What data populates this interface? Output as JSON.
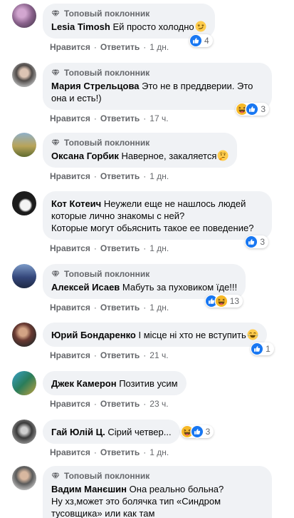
{
  "colors": {
    "bubble": "#f0f2f5",
    "text": "#050505",
    "secondary_text": "#65676b",
    "like_blue": "#1877f2",
    "haha_yellow": "#f7b928"
  },
  "separator": "·",
  "comments": [
    {
      "badge": "Топовый поклонник",
      "badge_icon": "diamond-icon",
      "author": "Lesia Timosh",
      "text": "Ей просто холодно",
      "text_emoji": "smirking-face-emoji-icon",
      "reactions": {
        "icons": [
          "like-reaction-icon"
        ],
        "count": "4"
      },
      "actions": {
        "like": "Нравится",
        "reply": "Ответить",
        "time": "1 дн."
      }
    },
    {
      "badge": "Топовый поклонник",
      "badge_icon": "diamond-icon",
      "author": "Мария Стрельцова",
      "text": "Это не в преддверии. Это она и есть!)",
      "reactions": {
        "icons": [
          "haha-reaction-icon",
          "like-reaction-icon"
        ],
        "count": "3"
      },
      "actions": {
        "like": "Нравится",
        "reply": "Ответить",
        "time": "17 ч."
      }
    },
    {
      "badge": "Топовый поклонник",
      "badge_icon": "diamond-icon",
      "author": "Оксана Горбик",
      "text": "Наверное, закаляется",
      "text_emoji": "thinking-face-emoji-icon",
      "actions": {
        "like": "Нравится",
        "reply": "Ответить",
        "time": "1 дн."
      }
    },
    {
      "author": "Кот Котеич",
      "text": "Неужели еще не нашлось людей которые лично знакомы с ней?\nКоторые могут обьяснить такое ее поведение?",
      "reactions": {
        "icons": [
          "like-reaction-icon"
        ],
        "count": "3"
      },
      "actions": {
        "like": "Нравится",
        "reply": "Ответить",
        "time": "1 дн."
      }
    },
    {
      "badge": "Топовый поклонник",
      "badge_icon": "diamond-icon",
      "author": "Алексей Исаев",
      "text": "Мабуть за пуховиком їде!!!",
      "reactions": {
        "icons": [
          "like-reaction-icon",
          "haha-reaction-icon"
        ],
        "count": "13"
      },
      "actions": {
        "like": "Нравится",
        "reply": "Ответить",
        "time": "1 дн."
      }
    },
    {
      "author": "Юрий Бондаренко",
      "text": "І місце ні хто не вступить",
      "text_emoji": "face-with-tears-of-joy-emoji-icon",
      "reactions": {
        "icons": [
          "like-reaction-icon"
        ],
        "count": "1"
      },
      "actions": {
        "like": "Нравится",
        "reply": "Ответить",
        "time": "21 ч."
      }
    },
    {
      "author": "Джек Камерон",
      "text": "Позитив усим",
      "actions": {
        "like": "Нравится",
        "reply": "Ответить",
        "time": "23 ч."
      }
    },
    {
      "author": "Гай Юлій Ц.",
      "text": "Сірий четвер...",
      "reactions": {
        "icons": [
          "haha-reaction-icon",
          "like-reaction-icon"
        ],
        "count": "3"
      },
      "actions": {
        "like": "Нравится",
        "reply": "Ответить",
        "time": "1 дн."
      }
    },
    {
      "badge": "Топовый поклонник",
      "badge_icon": "diamond-icon",
      "author": "Вадим Манєшин",
      "text": "Она реально больна?\nНу хз,может это болячка тип «Синдром тусовщика» или как там"
    }
  ]
}
